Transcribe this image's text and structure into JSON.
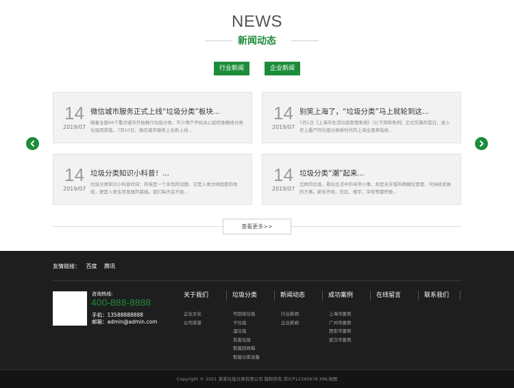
{
  "section": {
    "title_en": "NEWS",
    "title_cn": "新闻动态",
    "tabs": [
      "行业新闻",
      "企业新闻"
    ]
  },
  "news": [
    {
      "day": "14",
      "ym": "2019/07",
      "title": "微信城市服务正式上线“垃圾分类”板块...",
      "desc": "随着全国46个重点城市开始推行垃圾分类，不少用户开始关心如何准确地分类垃圾而苦恼。7月10日，微信城市服务上全新上线..."
    },
    {
      "day": "14",
      "ym": "2019/07",
      "title": "别笑上海了，“垃圾分类”马上就轮到这...",
      "desc": "7月1日《上海市生活垃圾管理条例》（以下简称条例）正式实施的首日，进入史上最严的垃圾分类新时代的上海全面来临收..."
    },
    {
      "day": "14",
      "ym": "2019/07",
      "title": "垃圾分类知识小科普！...",
      "desc": "垃圾分类知识小科普时间：环保是一个永恒的话题，它是人类文明程度的体现，更是人类生存发展的基础。我们每天会不经..."
    },
    {
      "day": "14",
      "ym": "2019/07",
      "title": "垃圾分类“潮”起来...",
      "desc": "怎样的垃圾，看似生活中的寻常小事，却是关乎城市精细化管理、可持续发展的大事。新年开局，社区、楼宇、学校等都积极..."
    }
  ],
  "more_label": "查看更多>>",
  "footer": {
    "links_label": "友情链接：",
    "links": [
      "百度",
      "腾讯"
    ],
    "hotline_label": "咨询热线:",
    "hotline": "400-888-8888",
    "phone_label": "手机：",
    "phone": "13588888888",
    "email_label": "邮箱：",
    "email": "admin@admin.com",
    "columns": [
      {
        "title": "关于我们",
        "items": [
          "企业文化",
          "公司荣誉"
        ]
      },
      {
        "title": "垃圾分类",
        "items": [
          "可回收垃圾",
          "干垃圾",
          "湿垃圾",
          "有害垃圾",
          "智能回收箱",
          "智能分拣设备"
        ]
      },
      {
        "title": "新闻动态",
        "items": [
          "行业新闻",
          "企业新闻"
        ]
      },
      {
        "title": "成功案例",
        "items": [
          "上海市案例",
          "广州市案例",
          "西安市案例",
          "武汉市案例"
        ]
      },
      {
        "title": "在线留言",
        "items": []
      },
      {
        "title": "联系我们",
        "items": []
      }
    ],
    "copyright": "Copyright © 2021 某某垃圾分类有限公司 版权所有   苏ICP12345678   XML地图"
  }
}
